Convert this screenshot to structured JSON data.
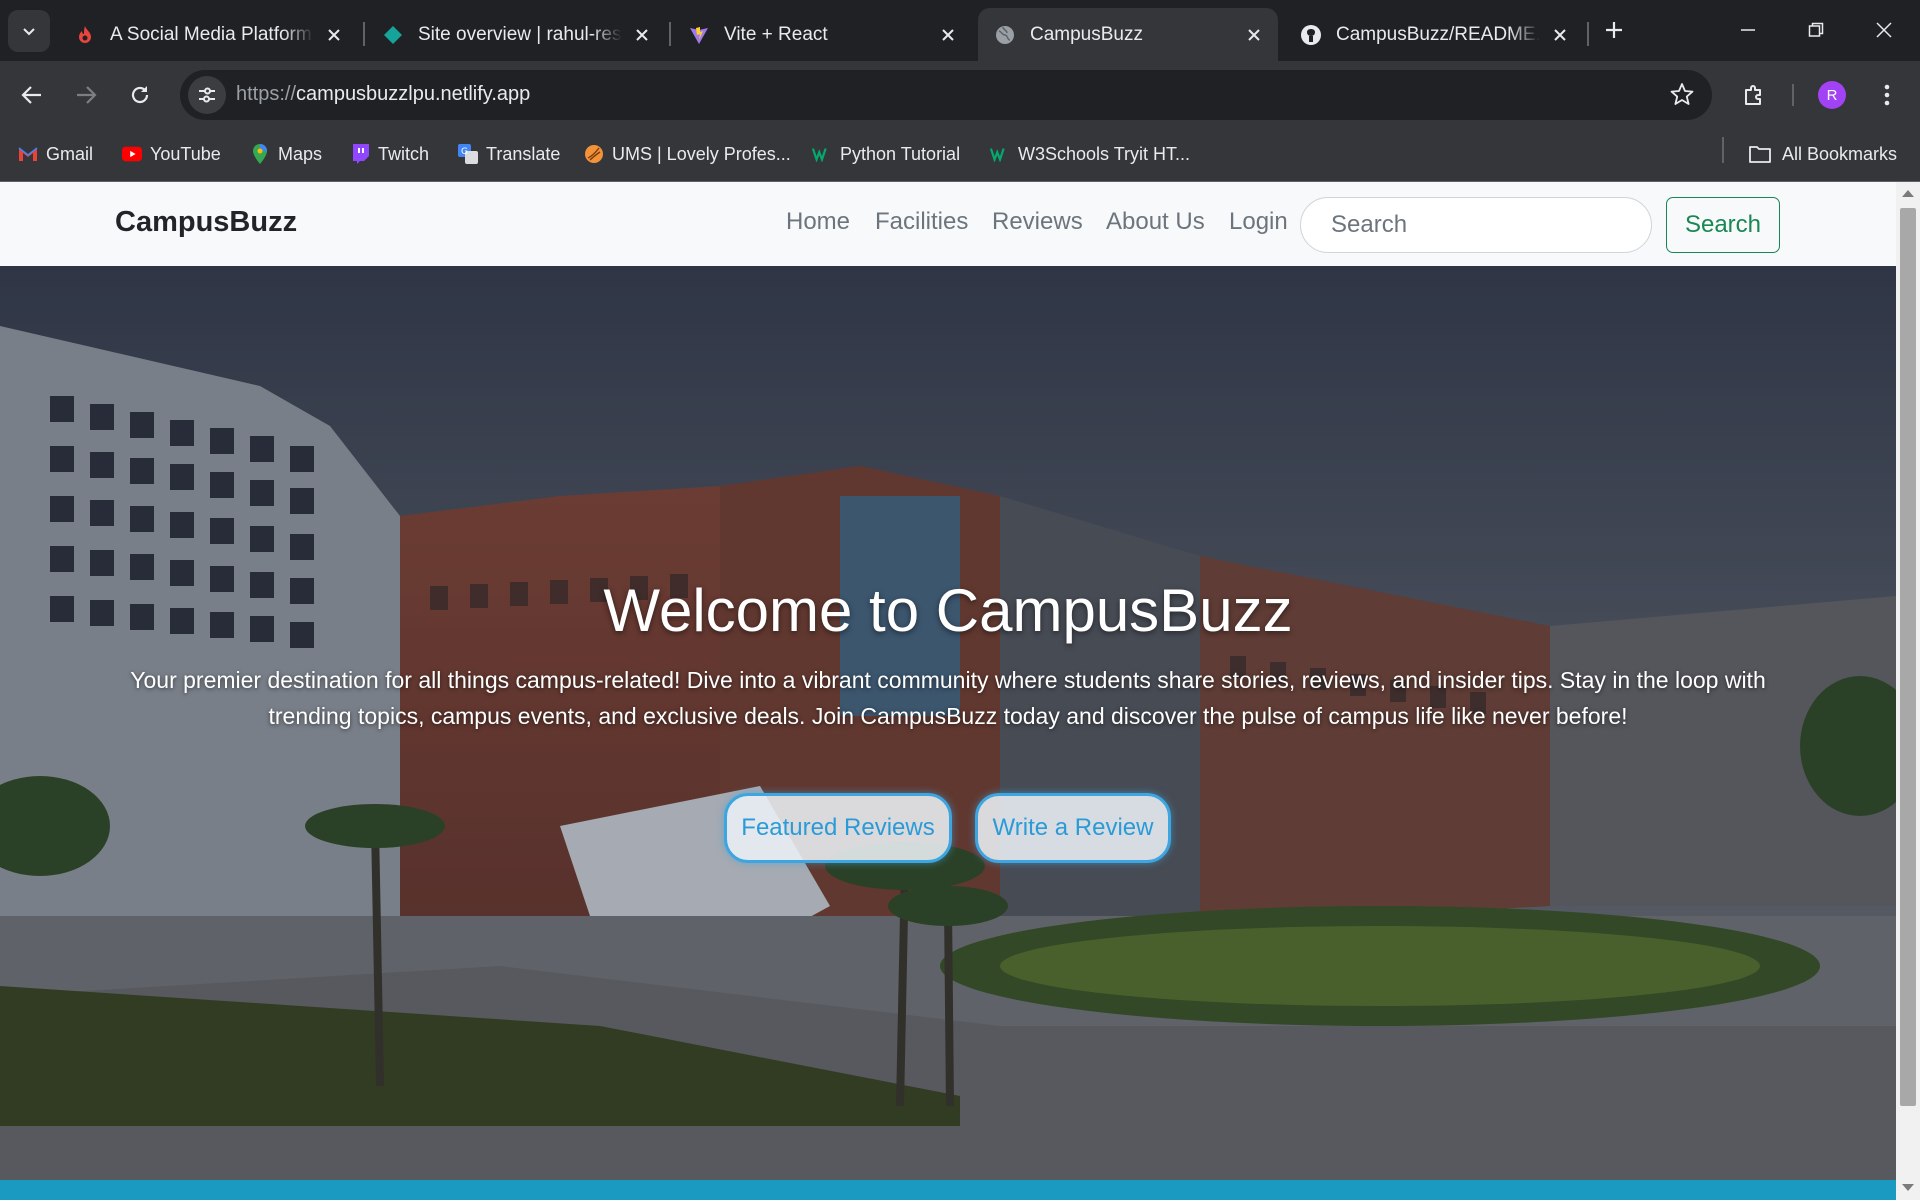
{
  "browser": {
    "tabs": [
      {
        "title": "A Social Media Platform f",
        "icon": "flame-icon"
      },
      {
        "title": "Site overview | rahul-resu",
        "icon": "netlify-icon"
      },
      {
        "title": "Vite + React",
        "icon": "vite-icon"
      },
      {
        "title": "CampusBuzz",
        "icon": "globe-icon"
      },
      {
        "title": "CampusBuzz/README.m",
        "icon": "github-icon"
      }
    ],
    "active_tab": 3,
    "url": {
      "scheme": "https://",
      "host": "campusbuzzlpu.netlify.app"
    },
    "profile_initial": "R",
    "bookmarks": [
      {
        "label": "Gmail",
        "icon": "gmail-icon"
      },
      {
        "label": "YouTube",
        "icon": "youtube-icon"
      },
      {
        "label": "Maps",
        "icon": "maps-icon"
      },
      {
        "label": "Twitch",
        "icon": "twitch-icon"
      },
      {
        "label": "Translate",
        "icon": "translate-icon"
      },
      {
        "label": "UMS | Lovely Profes...",
        "icon": "ums-icon"
      },
      {
        "label": "Python Tutorial",
        "icon": "w3schools-icon"
      },
      {
        "label": "W3Schools Tryit HT...",
        "icon": "w3schools-icon"
      }
    ],
    "all_bookmarks_label": "All Bookmarks"
  },
  "site": {
    "brand": "CampusBuzz",
    "nav": [
      "Home",
      "Facilities",
      "Reviews",
      "About Us",
      "Login"
    ],
    "search_placeholder": "Search",
    "search_button": "Search"
  },
  "hero": {
    "title": "Welcome to CampusBuzz",
    "text": "Your premier destination for all things campus-related! Dive into a vibrant community where students share stories, reviews, and insider tips. Stay in the loop with trending topics, campus events, and exclusive deals. Join CampusBuzz today and discover the pulse of campus life like never before!",
    "buttons": [
      "Featured Reviews",
      "Write a Review"
    ]
  },
  "colors": {
    "chrome_dark": "#202124",
    "chrome_toolbar": "#35363a",
    "nav_link": "#6c757d",
    "search_green": "#198754",
    "hero_button_blue": "#2b9bd8",
    "bottom_strip": "#1a9ac0"
  }
}
